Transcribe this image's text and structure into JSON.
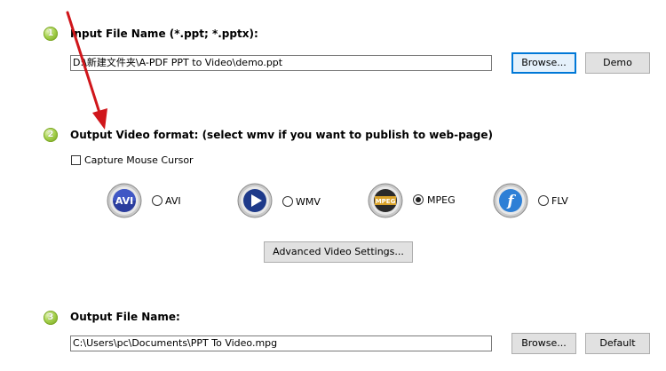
{
  "input_section": {
    "step": "1",
    "title": "Input File Name (*.ppt; *.pptx):",
    "file_path": "D:\\新建文件夹\\A-PDF PPT to Video\\demo.ppt",
    "browse_label": "Browse...",
    "demo_label": "Demo"
  },
  "format_section": {
    "step": "2",
    "title": "Output Video format: (select wmv if you want to publish to web-page)",
    "capture_cursor_label": "Capture Mouse Cursor",
    "capture_cursor_checked": false,
    "formats": [
      {
        "id": "avi",
        "icon_text": "AVI",
        "label": "AVI",
        "selected": false
      },
      {
        "id": "wmv",
        "icon_text": "",
        "label": "WMV",
        "selected": false
      },
      {
        "id": "mpeg",
        "icon_text": "MPEG",
        "label": "MPEG",
        "selected": true
      },
      {
        "id": "flv",
        "icon_text": "f",
        "label": "FLV",
        "selected": false
      }
    ],
    "advanced_label": "Advanced Video Settings..."
  },
  "output_section": {
    "step": "3",
    "title": "Output File Name:",
    "file_path": "C:\\Users\\pc\\Documents\\PPT To Video.mpg",
    "browse_label": "Browse...",
    "default_label": "Default"
  },
  "colors": {
    "arrow": "#d0161b",
    "focus_border": "#0078d7"
  }
}
